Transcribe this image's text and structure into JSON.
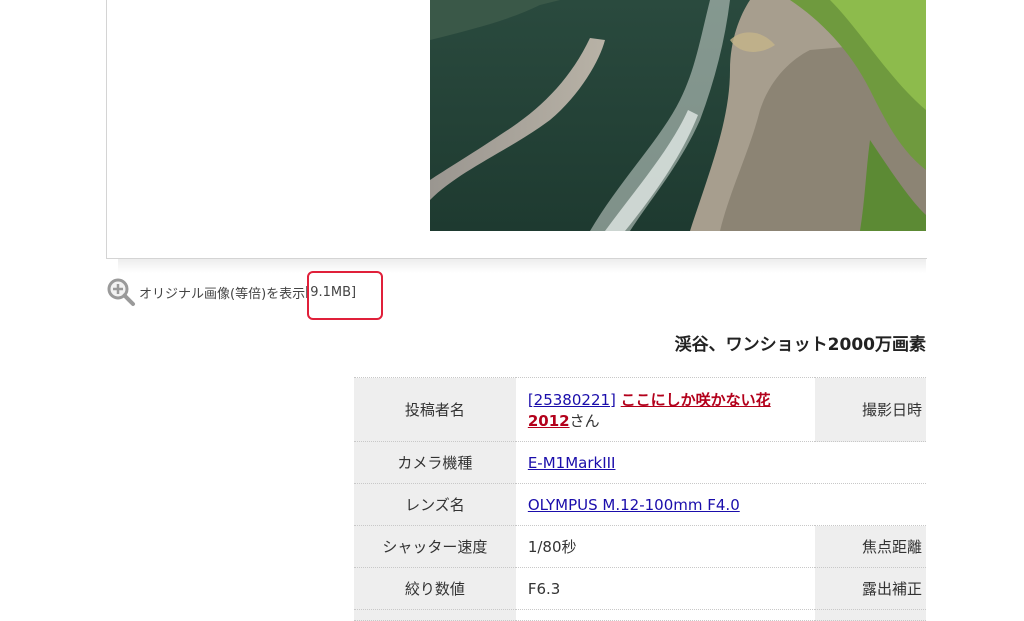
{
  "original_link": {
    "label": "オリジナル画像(等倍)を表示",
    "size": "[9.1MB]"
  },
  "photo_title": "渓谷、ワンショット2000万画素",
  "info_table": {
    "poster_key": "投稿者名",
    "poster_id": "[25380221]",
    "poster_name_a": "ここにしか咲かない花",
    "poster_name_b": "2012",
    "poster_suffix": "さん",
    "shot_date_key": "撮影日時",
    "camera_key": "カメラ機種",
    "camera_value": "E-M1MarkIII",
    "lens_key": "レンズ名",
    "lens_value": "OLYMPUS M.12-100mm F4.0",
    "shutter_key": "シャッター速度",
    "shutter_value": "1/80秒",
    "focal_key": "焦点距離",
    "aperture_key": "絞り数値",
    "aperture_value": "F6.3",
    "exposure_key": "露出補正"
  },
  "colors": {
    "highlight": "#e0203a",
    "link": "#1a0dab",
    "poster_link": "#b3001b"
  }
}
